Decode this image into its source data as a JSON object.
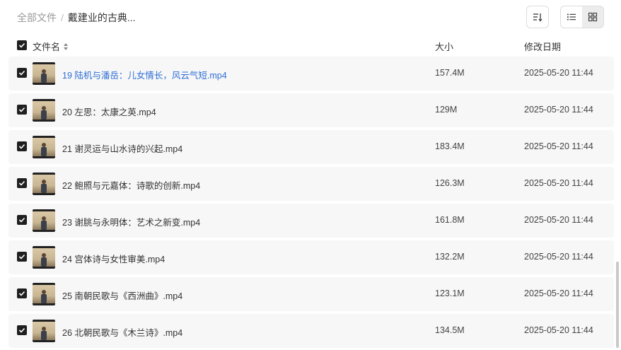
{
  "breadcrumb": {
    "root": "全部文件",
    "separator": "/",
    "current": "戴建业的古典..."
  },
  "icons": {
    "sort": "sort-descending-icon",
    "list_view": "list-view-icon",
    "grid_view": "grid-view-icon",
    "check": "check-icon"
  },
  "table": {
    "headers": {
      "name": "文件名",
      "size": "大小",
      "modified": "修改日期"
    },
    "rows": [
      {
        "name": "19 陆机与潘岳：儿女情长，风云气短.mp4",
        "size": "157.4M",
        "modified": "2025-05-20 11:44",
        "highlight": true
      },
      {
        "name": "20 左思：太康之英.mp4",
        "size": "129M",
        "modified": "2025-05-20 11:44"
      },
      {
        "name": "21 谢灵运与山水诗的兴起.mp4",
        "size": "183.4M",
        "modified": "2025-05-20 11:44"
      },
      {
        "name": "22 鲍照与元嘉体：诗歌的创新.mp4",
        "size": "126.3M",
        "modified": "2025-05-20 11:44"
      },
      {
        "name": "23 谢朓与永明体：艺术之新变.mp4",
        "size": "161.8M",
        "modified": "2025-05-20 11:44"
      },
      {
        "name": "24 宫体诗与女性审美.mp4",
        "size": "132.2M",
        "modified": "2025-05-20 11:44"
      },
      {
        "name": "25 南朝民歌与《西洲曲》.mp4",
        "size": "123.1M",
        "modified": "2025-05-20 11:44"
      },
      {
        "name": "26 北朝民歌与《木兰诗》.mp4",
        "size": "134.5M",
        "modified": "2025-05-20 11:44"
      }
    ]
  },
  "colors": {
    "link": "#2f6fd6",
    "row_bg": "#f7f7f7",
    "checkbox": "#1f1f1f"
  }
}
